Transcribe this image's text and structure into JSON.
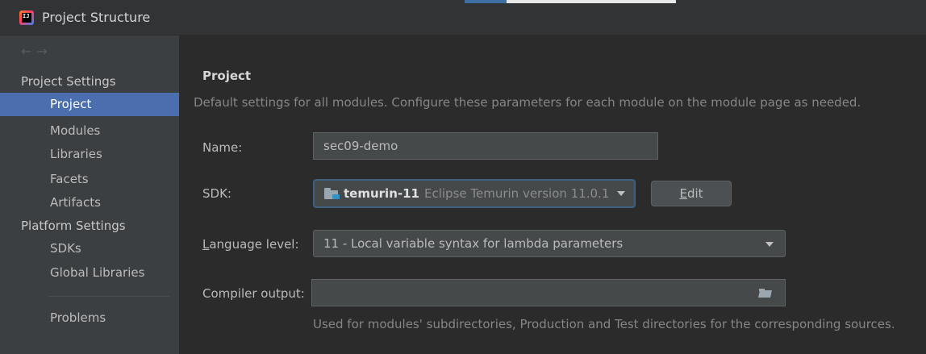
{
  "window": {
    "title": "Project Structure"
  },
  "sidebar": {
    "back_arrow": "←",
    "forward_arrow": "→",
    "project_settings_header": "Project Settings",
    "project_settings_items": [
      "Project",
      "Modules",
      "Libraries",
      "Facets",
      "Artifacts"
    ],
    "platform_settings_header": "Platform Settings",
    "platform_settings_items": [
      "SDKs",
      "Global Libraries"
    ],
    "problems": "Problems",
    "selected_item": "Project"
  },
  "main": {
    "heading": "Project",
    "description": "Default settings for all modules. Configure these parameters for each module on the module page as needed.",
    "name_label": "Name:",
    "name_value": "sec09-demo",
    "sdk_label": "SDK:",
    "sdk_name": "temurin-11",
    "sdk_version": "Eclipse Temurin version 11.0.1",
    "edit_button_prefix": "",
    "edit_button_mnemonic": "E",
    "edit_button_rest": "dit",
    "language_level_label_mnemonic": "L",
    "language_level_label_rest": "anguage level:",
    "language_level_value": "11 - Local variable syntax for lambda parameters",
    "compiler_output_label": "Compiler output:",
    "compiler_output_value": "",
    "compiler_output_hint": "Used for modules' subdirectories, Production and Test directories for the corresponding sources."
  },
  "colors": {
    "selection": "#4b6eaf",
    "background": "#2b2b2b",
    "sidebar": "#3c3f41",
    "focus_border": "#3d6185"
  },
  "icons": {
    "app": "intellij-idea-icon",
    "sdk": "jdk-folder-icon",
    "browse": "open-folder-icon"
  }
}
